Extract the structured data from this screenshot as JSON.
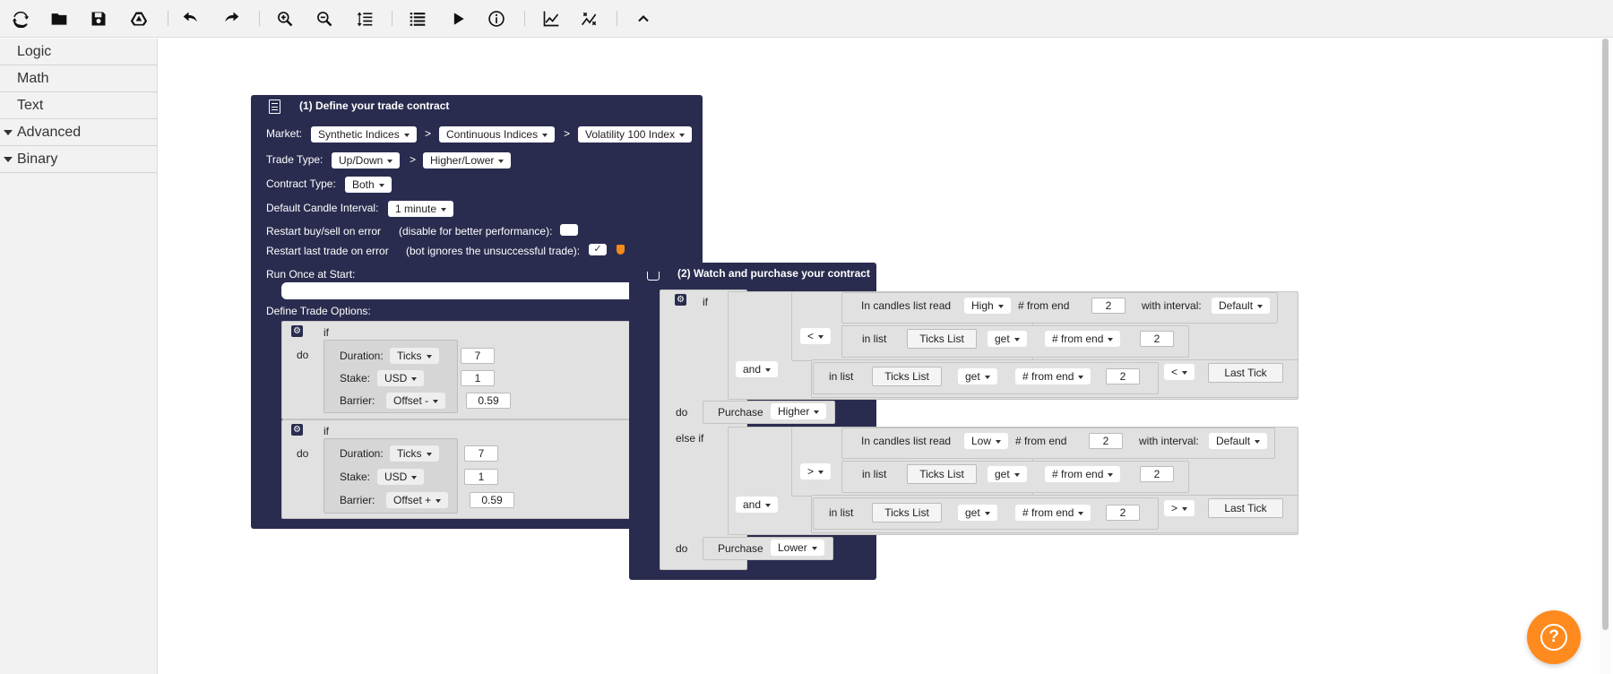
{
  "toolbar": {
    "buttons": [
      "reset-icon",
      "load-icon",
      "save-icon",
      "google-drive-icon",
      "undo-icon",
      "redo-icon",
      "zoom-in-icon",
      "zoom-out-icon",
      "rearrange-icon",
      "summary-icon",
      "run-icon",
      "info-icon",
      "chart-icon",
      "trading-view-icon",
      "collapse-icon"
    ]
  },
  "sidebar": {
    "items": [
      {
        "label": "Logic",
        "expandable": false
      },
      {
        "label": "Math",
        "expandable": false
      },
      {
        "label": "Text",
        "expandable": false
      },
      {
        "label": "Advanced",
        "expandable": true
      },
      {
        "label": "Binary",
        "expandable": true
      }
    ]
  },
  "block1": {
    "title": "(1) Define your trade contract",
    "market_label": "Market:",
    "market": "Synthetic Indices",
    "submarket": "Continuous Indices",
    "symbol": "Volatility 100 Index",
    "sep": ">",
    "trade_type_label": "Trade Type:",
    "trade_category": "Up/Down",
    "trade_type": "Higher/Lower",
    "contract_type_label": "Contract Type:",
    "contract_type": "Both",
    "candle_interval_label": "Default Candle Interval:",
    "candle_interval": "1 minute",
    "restart_error_label": "Restart buy/sell on error",
    "restart_error_hint": "(disable for better performance):",
    "restart_last_label": "Restart last trade on error",
    "restart_last_hint": "(bot ignores the unsuccessful trade):",
    "restart_last_check": "✓",
    "run_once_label": "Run Once at Start:",
    "trade_options_label": "Define Trade Options:",
    "if_label": "if",
    "do_label": "do",
    "options": [
      {
        "duration_label": "Duration:",
        "duration_unit": "Ticks",
        "duration": "7",
        "stake_label": "Stake:",
        "currency": "USD",
        "stake": "1",
        "barrier_label": "Barrier:",
        "barrier_type": "Offset -",
        "barrier": "0.59"
      },
      {
        "duration_label": "Duration:",
        "duration_unit": "Ticks",
        "duration": "7",
        "stake_label": "Stake:",
        "currency": "USD",
        "stake": "1",
        "barrier_label": "Barrier:",
        "barrier_type": "Offset +",
        "barrier": "0.59"
      }
    ]
  },
  "block2": {
    "title": "(2) Watch and purchase your contract",
    "if_label": "if",
    "do_label": "do",
    "else_if_label": "else if",
    "and_label": "and",
    "candles_label": "In candles list read",
    "from_end_label": "# from end",
    "with_interval_label": "with interval:",
    "in_list_label": "in list",
    "ticks_list": "Ticks List",
    "get": "get",
    "from_end_dd": "# from end",
    "last_tick": "Last Tick",
    "purchase_label": "Purchase",
    "branch1": {
      "field": "High",
      "n1": "2",
      "interval": "Default",
      "op1": "<",
      "n2": "2",
      "n3": "2",
      "op2": "<",
      "purchase": "Higher"
    },
    "branch2": {
      "field": "Low",
      "n1": "2",
      "interval": "Default",
      "op1": ">",
      "n2": "2",
      "n3": "2",
      "op2": ">",
      "purchase": "Lower"
    }
  },
  "help": {
    "symbol": "?"
  }
}
